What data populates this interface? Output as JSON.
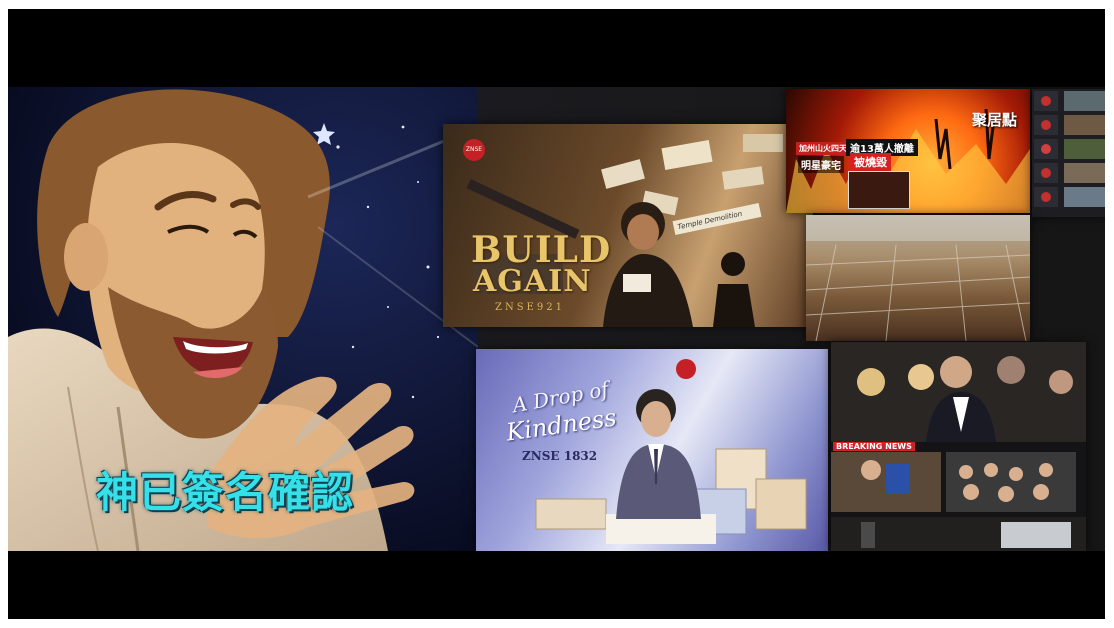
{
  "caption": "神已簽名確認",
  "build_again": {
    "logo": "ZNSE",
    "title_line1": "BUILD",
    "title_line2": "AGAIN",
    "code": "ZNSE921",
    "paper_note": "Temple Demolition"
  },
  "fire_news": {
    "location_banner": "加州山火四天日",
    "headline_top": "逾13萬人撤離",
    "headline_sub": "明星豪宅",
    "headline_red": "被燒毀",
    "corner_text": "聚居點"
  },
  "drop_kindness": {
    "title_line1": "A Drop of",
    "title_line2": "Kindness",
    "code": "ZNSE 1832"
  },
  "news_collage": {
    "breaking": "BREAKING NEWS"
  },
  "colors": {
    "caption_fill": "#35e0e8",
    "gold": "#d9b45a",
    "fire_orange": "#ff7a1a",
    "breaking_red": "#d0202a"
  }
}
